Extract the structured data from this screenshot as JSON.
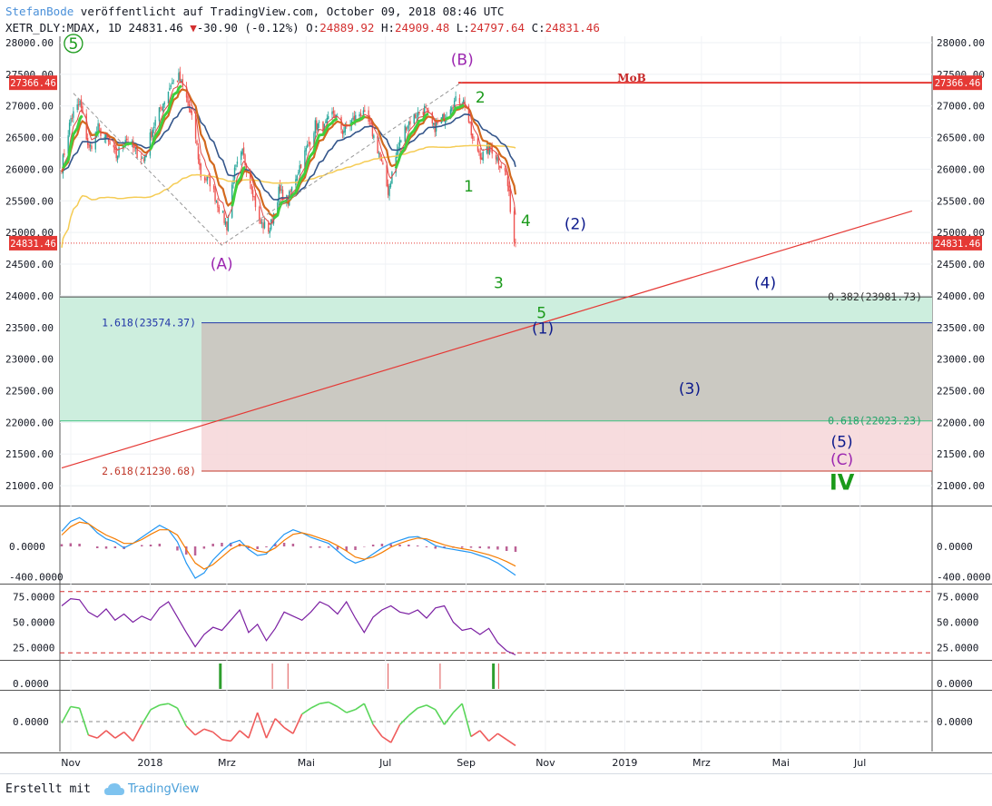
{
  "header": {
    "author": "StefanBode",
    "published": "veröffentlicht auf TradingView.com, October 09, 2018 08:46 UTC",
    "symbol_line": "XETR_DLY:MDAX, 1D 24831.46",
    "change": "-30.90 (-0.12%)",
    "ohlc_O_label": "O:",
    "ohlc_O": "24889.92",
    "ohlc_H_label": "H:",
    "ohlc_H": "24909.48",
    "ohlc_L_label": "L:",
    "ohlc_L": "24797.64",
    "ohlc_C_label": "C:",
    "ohlc_C": "24831.46"
  },
  "footer": {
    "made_with": "Erstellt mit",
    "brand": "TradingView"
  },
  "colors": {
    "bull": "#26a69a",
    "bear": "#ef5350",
    "green_count": "#1a9a1a",
    "purple_count": "#9c27b0",
    "navy_count": "#0d1a8c",
    "red_line": "#e53935",
    "fib_green": "#cdeede",
    "fib_red": "#f6d6d8",
    "ema_slow": "#34568b",
    "ma200": "#f5cc55",
    "macd": "#2196f3",
    "signal": "#f57c00",
    "rsi": "#7b1fa2"
  },
  "chart_data": [
    {
      "type": "candlestick",
      "panel": "price",
      "ylim": [
        20700,
        28100
      ],
      "y_ticks": [
        "28000.00",
        "27500.00",
        "27000.00",
        "26500.00",
        "26000.00",
        "25500.00",
        "25000.00",
        "24500.00",
        "24000.00",
        "23500.00",
        "23000.00",
        "22500.00",
        "22000.00",
        "21500.00",
        "21000.00"
      ],
      "x_ticks": [
        "Nov",
        "2018",
        "Mrz",
        "Mai",
        "Jul",
        "Sep",
        "Nov",
        "2019",
        "Mrz",
        "Mai",
        "Jul"
      ],
      "x_tick_dates": [
        "2017-11-01",
        "2018-01-01",
        "2018-03-01",
        "2018-05-01",
        "2018-07-01",
        "2018-09-01",
        "2018-11-01",
        "2019-01-01",
        "2019-03-01",
        "2019-05-01",
        "2019-07-01"
      ],
      "close_anchors": [
        [
          "2017-10-25",
          26050
        ],
        [
          "2017-11-01",
          26800
        ],
        [
          "2017-11-08",
          27050
        ],
        [
          "2017-11-15",
          26300
        ],
        [
          "2017-11-22",
          26650
        ],
        [
          "2017-11-29",
          26450
        ],
        [
          "2017-12-06",
          26200
        ],
        [
          "2017-12-13",
          26500
        ],
        [
          "2017-12-20",
          26300
        ],
        [
          "2017-12-27",
          26150
        ],
        [
          "2018-01-03",
          26650
        ],
        [
          "2018-01-10",
          27000
        ],
        [
          "2018-01-17",
          27350
        ],
        [
          "2018-01-23",
          27450
        ],
        [
          "2018-01-30",
          27050
        ],
        [
          "2018-02-05",
          26500
        ],
        [
          "2018-02-09",
          25900
        ],
        [
          "2018-02-16",
          25800
        ],
        [
          "2018-02-23",
          25400
        ],
        [
          "2018-03-01",
          25100
        ],
        [
          "2018-03-06",
          25900
        ],
        [
          "2018-03-13",
          26250
        ],
        [
          "2018-03-20",
          25750
        ],
        [
          "2018-03-26",
          25150
        ],
        [
          "2018-04-03",
          25050
        ],
        [
          "2018-04-10",
          25650
        ],
        [
          "2018-04-17",
          25500
        ],
        [
          "2018-04-24",
          25950
        ],
        [
          "2018-05-01",
          26300
        ],
        [
          "2018-05-08",
          26700
        ],
        [
          "2018-05-15",
          26650
        ],
        [
          "2018-05-22",
          26900
        ],
        [
          "2018-05-29",
          26600
        ],
        [
          "2018-06-05",
          26750
        ],
        [
          "2018-06-12",
          26900
        ],
        [
          "2018-06-19",
          26700
        ],
        [
          "2018-06-26",
          26250
        ],
        [
          "2018-07-03",
          25650
        ],
        [
          "2018-07-10",
          26300
        ],
        [
          "2018-07-17",
          26700
        ],
        [
          "2018-07-24",
          26850
        ],
        [
          "2018-07-31",
          26950
        ],
        [
          "2018-08-07",
          26650
        ],
        [
          "2018-08-14",
          26800
        ],
        [
          "2018-08-21",
          27050
        ],
        [
          "2018-08-28",
          27100
        ],
        [
          "2018-08-31",
          27050
        ],
        [
          "2018-09-06",
          26450
        ],
        [
          "2018-09-13",
          26200
        ],
        [
          "2018-09-20",
          26350
        ],
        [
          "2018-09-27",
          26100
        ],
        [
          "2018-10-02",
          25900
        ],
        [
          "2018-10-05",
          25400
        ],
        [
          "2018-10-08",
          24862
        ],
        [
          "2018-10-09",
          24831.46
        ]
      ],
      "last_close": "24831.46",
      "mob_level": "27366.46",
      "mob_label": "MoB",
      "fib_levels": [
        {
          "label": "0.382(23981.73)",
          "value": 23981.73
        },
        {
          "label": "1.618(23574.37)",
          "value": 23574.37
        },
        {
          "label": "0.618(22023.23)",
          "value": 22023.23
        },
        {
          "label": "2.618(21230.68)",
          "value": 21230.68
        }
      ],
      "trendline": {
        "from": [
          "2017-10-25",
          21280
        ],
        "to": [
          "2019-08-10",
          25340
        ]
      },
      "wave_labels": [
        {
          "text": "5",
          "date": "2017-11-03",
          "y": 27900,
          "style": "circle-green"
        },
        {
          "text": "(A)",
          "date": "2018-02-25",
          "y": 24420,
          "style": "purple"
        },
        {
          "text": "(B)",
          "date": "2018-08-29",
          "y": 27650,
          "style": "purple"
        },
        {
          "text": "2",
          "date": "2018-09-12",
          "y": 27050,
          "style": "green"
        },
        {
          "text": "1",
          "date": "2018-09-03",
          "y": 25650,
          "style": "green"
        },
        {
          "text": "4",
          "date": "2018-10-17",
          "y": 25100,
          "style": "green"
        },
        {
          "text": "3",
          "date": "2018-09-26",
          "y": 24120,
          "style": "green"
        },
        {
          "text": "5",
          "date": "2018-10-29",
          "y": 23650,
          "style": "green"
        },
        {
          "text": "(2)",
          "date": "2018-11-24",
          "y": 25050,
          "style": "navy"
        },
        {
          "text": "(4)",
          "date": "2019-04-19",
          "y": 24120,
          "style": "navy"
        },
        {
          "text": "(1)",
          "date": "2018-10-30",
          "y": 23400,
          "style": "navy"
        },
        {
          "text": "(3)",
          "date": "2019-02-20",
          "y": 22450,
          "style": "navy"
        },
        {
          "text": "(5)",
          "date": "2019-06-17",
          "y": 21610,
          "style": "navy"
        },
        {
          "text": "(C)",
          "date": "2019-06-17",
          "y": 21330,
          "style": "purple"
        },
        {
          "text": "IV",
          "date": "2019-06-17",
          "y": 20940,
          "style": "green-bold"
        }
      ]
    },
    {
      "type": "line",
      "panel": "macd",
      "y_ticks": [
        "0.0000",
        "-400.0000"
      ],
      "series": [
        {
          "role": "macd",
          "values": [
            200,
            330,
            380,
            300,
            180,
            100,
            60,
            -20,
            40,
            120,
            200,
            280,
            220,
            60,
            -220,
            -420,
            -350,
            -180,
            -60,
            40,
            80,
            -40,
            -120,
            -100,
            40,
            160,
            220,
            180,
            120,
            80,
            40,
            -60,
            -160,
            -220,
            -180,
            -100,
            -20,
            40,
            80,
            120,
            130,
            80,
            10,
            -20,
            -40,
            -60,
            -80,
            -120,
            -160,
            -220,
            -300,
            -380
          ]
        },
        {
          "role": "signal",
          "values": [
            150,
            260,
            320,
            300,
            220,
            150,
            100,
            40,
            40,
            90,
            160,
            220,
            220,
            150,
            -40,
            -220,
            -300,
            -240,
            -140,
            -40,
            20,
            0,
            -60,
            -80,
            -20,
            80,
            160,
            180,
            150,
            110,
            70,
            10,
            -60,
            -140,
            -170,
            -140,
            -80,
            -10,
            40,
            80,
            110,
            100,
            60,
            20,
            -10,
            -30,
            -50,
            -80,
            -110,
            -150,
            -200,
            -260
          ]
        }
      ]
    },
    {
      "type": "line",
      "panel": "rsi",
      "ylim": [
        14,
        86
      ],
      "y_ticks": [
        "75.0000",
        "50.0000",
        "25.0000"
      ],
      "levels": [
        80,
        20
      ],
      "series": [
        {
          "name": "RSI",
          "values": [
            66,
            73,
            72,
            60,
            55,
            63,
            52,
            58,
            50,
            56,
            52,
            64,
            70,
            55,
            40,
            26,
            38,
            45,
            42,
            52,
            62,
            40,
            48,
            32,
            44,
            60,
            56,
            52,
            60,
            70,
            66,
            58,
            70,
            54,
            40,
            55,
            62,
            66,
            60,
            58,
            62,
            54,
            64,
            66,
            50,
            42,
            44,
            38,
            44,
            30,
            22,
            18
          ]
        }
      ]
    },
    {
      "type": "bar",
      "panel": "signals",
      "y_ticks": [
        "0.0000"
      ],
      "events": [
        {
          "date": "2018-02-24",
          "color": "green",
          "weight": "thick"
        },
        {
          "date": "2018-04-05",
          "color": "red",
          "weight": "thin"
        },
        {
          "date": "2018-04-17",
          "color": "red",
          "weight": "thin"
        },
        {
          "date": "2018-07-03",
          "color": "red",
          "weight": "thin"
        },
        {
          "date": "2018-08-12",
          "color": "red",
          "weight": "thin"
        },
        {
          "date": "2018-09-22",
          "color": "green",
          "weight": "thick"
        },
        {
          "date": "2018-09-26",
          "color": "red",
          "weight": "thin"
        }
      ]
    },
    {
      "type": "line",
      "panel": "oscillator",
      "y_ticks": [
        "0.0000"
      ],
      "series": [
        {
          "name": "Oscillator",
          "values": [
            -10,
            100,
            90,
            -90,
            -110,
            -60,
            -110,
            -70,
            -130,
            -20,
            80,
            110,
            120,
            90,
            -30,
            -90,
            -50,
            -70,
            -120,
            -130,
            -60,
            -110,
            60,
            -110,
            20,
            -40,
            -80,
            50,
            90,
            120,
            130,
            100,
            60,
            80,
            120,
            -20,
            -100,
            -140,
            -20,
            40,
            90,
            110,
            80,
            -20,
            60,
            120,
            -100,
            -60,
            -130,
            -80,
            -120,
            -160
          ]
        }
      ]
    }
  ]
}
